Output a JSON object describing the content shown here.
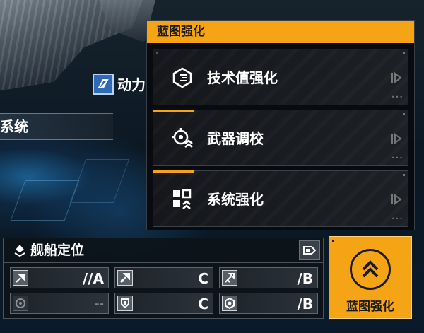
{
  "colors": {
    "accent": "#f5a415",
    "panel_bg": "#0a0c10",
    "text": "#ffffff"
  },
  "left": {
    "module_label": "动力",
    "module_icon": "power-module-icon",
    "system_label": "系统"
  },
  "blueprint": {
    "title": "蓝图强化",
    "options": [
      {
        "label": "技术值强化",
        "icon": "tech-value-icon"
      },
      {
        "label": "武器调校",
        "icon": "weapon-calibrate-icon"
      },
      {
        "label": "系统强化",
        "icon": "system-enhance-icon"
      }
    ]
  },
  "positioning": {
    "title": "舰船定位",
    "stats": [
      {
        "grade": "//A",
        "icon": "assault-icon",
        "dim": false
      },
      {
        "grade": "C",
        "icon": "strike-icon",
        "dim": false
      },
      {
        "grade": "/B",
        "icon": "sniper-icon",
        "dim": false
      },
      {
        "grade": "--",
        "icon": "target-icon",
        "dim": true
      },
      {
        "grade": "C",
        "icon": "shield-icon",
        "dim": false
      },
      {
        "grade": "/B",
        "icon": "support-icon",
        "dim": false
      }
    ]
  },
  "action_button": {
    "label": "蓝图强化",
    "icon": "double-chevron-up-icon"
  }
}
